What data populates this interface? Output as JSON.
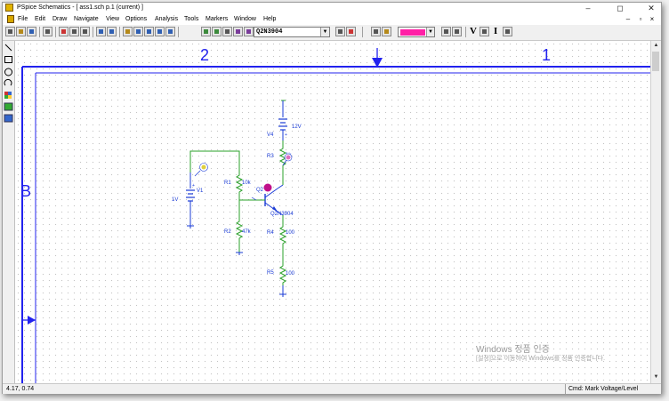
{
  "window": {
    "title": "PSpice Schematics - [ ass1.sch  p.1 (current)  ]",
    "controls": [
      "–",
      "◻",
      "✕"
    ],
    "mdi_controls": [
      "–",
      "▫",
      "×"
    ]
  },
  "menu": [
    "File",
    "Edit",
    "Draw",
    "Navigate",
    "View",
    "Options",
    "Analysis",
    "Tools",
    "Markers",
    "Window",
    "Help"
  ],
  "toolbar": {
    "part_name": "Q2N3904",
    "color_value": "#ff1fa6",
    "letters": [
      "V",
      "I"
    ]
  },
  "border": {
    "zone_labels_top": [
      "2",
      "1"
    ],
    "zone_label_left": "B"
  },
  "schematic": {
    "labels": {
      "v4": "V4",
      "v4_value": "12V",
      "v1": "V1",
      "v1_value": "1V",
      "r1": "R1",
      "r1_value": "10k",
      "r2": "R2",
      "r2_value": "47k",
      "r3": "R3",
      "r3_value": "1k",
      "r4": "R4",
      "r4_value": "100",
      "r5": "R5",
      "r5_value": "100",
      "q1": "Q2",
      "q1_model": "Q2N3904"
    },
    "colors": {
      "wire": "#2aa02a",
      "part": "#1a3bd6",
      "marker_yellow": "#e0d040",
      "marker_magenta": "#c0108a",
      "marker_pink": "#e070c0"
    }
  },
  "watermark": {
    "line1": "Windows 정품 인증",
    "line2": "[설정]으로 이동하여 Windows를 정품 인증합니다."
  },
  "status": {
    "coords": "4.17,  0.74",
    "command": "Cmd: Mark Voltage/Level"
  }
}
